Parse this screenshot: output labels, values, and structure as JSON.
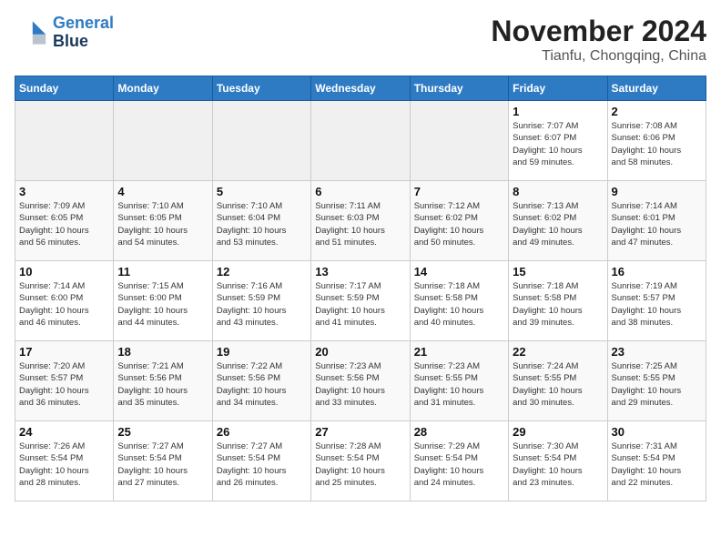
{
  "header": {
    "logo_line1": "General",
    "logo_line2": "Blue",
    "month": "November 2024",
    "location": "Tianfu, Chongqing, China"
  },
  "weekdays": [
    "Sunday",
    "Monday",
    "Tuesday",
    "Wednesday",
    "Thursday",
    "Friday",
    "Saturday"
  ],
  "weeks": [
    [
      {
        "day": "",
        "info": ""
      },
      {
        "day": "",
        "info": ""
      },
      {
        "day": "",
        "info": ""
      },
      {
        "day": "",
        "info": ""
      },
      {
        "day": "",
        "info": ""
      },
      {
        "day": "1",
        "info": "Sunrise: 7:07 AM\nSunset: 6:07 PM\nDaylight: 10 hours\nand 59 minutes."
      },
      {
        "day": "2",
        "info": "Sunrise: 7:08 AM\nSunset: 6:06 PM\nDaylight: 10 hours\nand 58 minutes."
      }
    ],
    [
      {
        "day": "3",
        "info": "Sunrise: 7:09 AM\nSunset: 6:05 PM\nDaylight: 10 hours\nand 56 minutes."
      },
      {
        "day": "4",
        "info": "Sunrise: 7:10 AM\nSunset: 6:05 PM\nDaylight: 10 hours\nand 54 minutes."
      },
      {
        "day": "5",
        "info": "Sunrise: 7:10 AM\nSunset: 6:04 PM\nDaylight: 10 hours\nand 53 minutes."
      },
      {
        "day": "6",
        "info": "Sunrise: 7:11 AM\nSunset: 6:03 PM\nDaylight: 10 hours\nand 51 minutes."
      },
      {
        "day": "7",
        "info": "Sunrise: 7:12 AM\nSunset: 6:02 PM\nDaylight: 10 hours\nand 50 minutes."
      },
      {
        "day": "8",
        "info": "Sunrise: 7:13 AM\nSunset: 6:02 PM\nDaylight: 10 hours\nand 49 minutes."
      },
      {
        "day": "9",
        "info": "Sunrise: 7:14 AM\nSunset: 6:01 PM\nDaylight: 10 hours\nand 47 minutes."
      }
    ],
    [
      {
        "day": "10",
        "info": "Sunrise: 7:14 AM\nSunset: 6:00 PM\nDaylight: 10 hours\nand 46 minutes."
      },
      {
        "day": "11",
        "info": "Sunrise: 7:15 AM\nSunset: 6:00 PM\nDaylight: 10 hours\nand 44 minutes."
      },
      {
        "day": "12",
        "info": "Sunrise: 7:16 AM\nSunset: 5:59 PM\nDaylight: 10 hours\nand 43 minutes."
      },
      {
        "day": "13",
        "info": "Sunrise: 7:17 AM\nSunset: 5:59 PM\nDaylight: 10 hours\nand 41 minutes."
      },
      {
        "day": "14",
        "info": "Sunrise: 7:18 AM\nSunset: 5:58 PM\nDaylight: 10 hours\nand 40 minutes."
      },
      {
        "day": "15",
        "info": "Sunrise: 7:18 AM\nSunset: 5:58 PM\nDaylight: 10 hours\nand 39 minutes."
      },
      {
        "day": "16",
        "info": "Sunrise: 7:19 AM\nSunset: 5:57 PM\nDaylight: 10 hours\nand 38 minutes."
      }
    ],
    [
      {
        "day": "17",
        "info": "Sunrise: 7:20 AM\nSunset: 5:57 PM\nDaylight: 10 hours\nand 36 minutes."
      },
      {
        "day": "18",
        "info": "Sunrise: 7:21 AM\nSunset: 5:56 PM\nDaylight: 10 hours\nand 35 minutes."
      },
      {
        "day": "19",
        "info": "Sunrise: 7:22 AM\nSunset: 5:56 PM\nDaylight: 10 hours\nand 34 minutes."
      },
      {
        "day": "20",
        "info": "Sunrise: 7:23 AM\nSunset: 5:56 PM\nDaylight: 10 hours\nand 33 minutes."
      },
      {
        "day": "21",
        "info": "Sunrise: 7:23 AM\nSunset: 5:55 PM\nDaylight: 10 hours\nand 31 minutes."
      },
      {
        "day": "22",
        "info": "Sunrise: 7:24 AM\nSunset: 5:55 PM\nDaylight: 10 hours\nand 30 minutes."
      },
      {
        "day": "23",
        "info": "Sunrise: 7:25 AM\nSunset: 5:55 PM\nDaylight: 10 hours\nand 29 minutes."
      }
    ],
    [
      {
        "day": "24",
        "info": "Sunrise: 7:26 AM\nSunset: 5:54 PM\nDaylight: 10 hours\nand 28 minutes."
      },
      {
        "day": "25",
        "info": "Sunrise: 7:27 AM\nSunset: 5:54 PM\nDaylight: 10 hours\nand 27 minutes."
      },
      {
        "day": "26",
        "info": "Sunrise: 7:27 AM\nSunset: 5:54 PM\nDaylight: 10 hours\nand 26 minutes."
      },
      {
        "day": "27",
        "info": "Sunrise: 7:28 AM\nSunset: 5:54 PM\nDaylight: 10 hours\nand 25 minutes."
      },
      {
        "day": "28",
        "info": "Sunrise: 7:29 AM\nSunset: 5:54 PM\nDaylight: 10 hours\nand 24 minutes."
      },
      {
        "day": "29",
        "info": "Sunrise: 7:30 AM\nSunset: 5:54 PM\nDaylight: 10 hours\nand 23 minutes."
      },
      {
        "day": "30",
        "info": "Sunrise: 7:31 AM\nSunset: 5:54 PM\nDaylight: 10 hours\nand 22 minutes."
      }
    ]
  ]
}
